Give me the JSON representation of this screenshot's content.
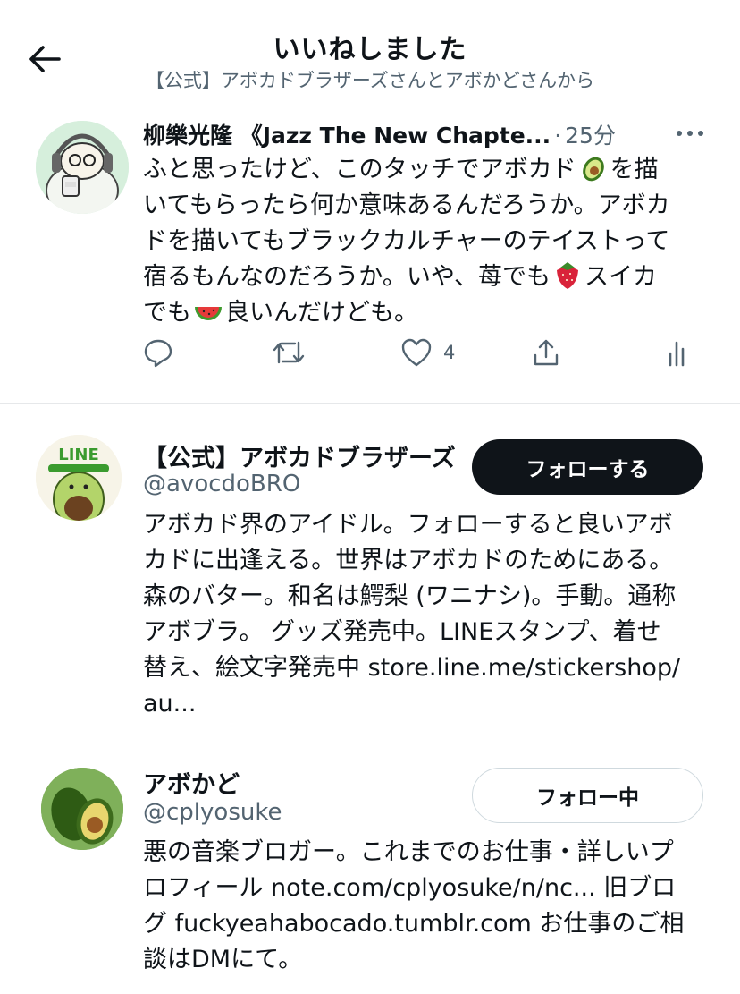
{
  "header": {
    "title": "いいねしました",
    "subtitle": "【公式】アボカドブラザーズさんとアボかどさんから",
    "back_icon": "arrow-left-icon"
  },
  "tweet": {
    "author_name": "柳樂光隆 《Jazz The New Chapte...",
    "dot": "·",
    "time": "25分",
    "text_lines": [
      "ふと思ったけど、このタッチでアボカド",
      "を描",
      "いてもらったら何か意味あるんだろうか。アボカ",
      "ドを描いてもブラックカルチャーのテイストって",
      "宿るもんなのだろうか。いや、苺でも",
      "スイカ",
      "でも",
      "良いんだけども。"
    ],
    "emojis": [
      "avocado-emoji",
      "strawberry-emoji",
      "watermelon-emoji"
    ],
    "like_count": "4"
  },
  "users": [
    {
      "name": "【公式】アボカドブラザーズ",
      "handle": "@avocdoBRO",
      "button": "フォローする",
      "bio_lines": [
        "アボカド界のアイドル。フォローすると良いアボ",
        "カドに出逢える。世界はアボカドのためにある。",
        "森のバター。和名は鰐梨 (ワニナシ)。手動。通称",
        "アボブラ。 グッズ発売中。LINEスタンプ、着せ",
        "替え、絵文字発売中 store.line.me/stickershop/",
        "au..."
      ],
      "avatar_label": "LINE"
    },
    {
      "name": "アボかど",
      "handle": "@cplyosuke",
      "button": "フォロー中",
      "bio_lines": [
        "悪の音楽ブロガー。これまでのお仕事・詳しいプ",
        "ロフィール note.com/cplyosuke/n/nc... 旧ブロ",
        "グ fuckyeahabocado.tumblr.com お仕事のご相",
        "談はDMにて。"
      ]
    }
  ],
  "colors": {
    "text": "#0f1419",
    "secondary": "#536471",
    "follow_button_bg": "#0f1419",
    "divider": "#e6e8ea"
  }
}
